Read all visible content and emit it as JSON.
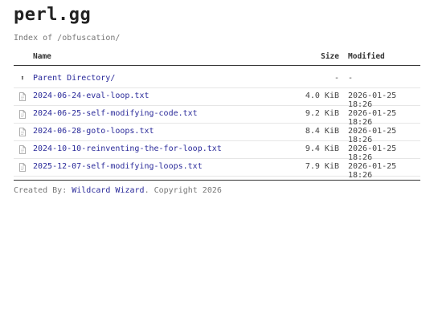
{
  "site": {
    "title": "perl.gg",
    "index_path": "Index of /obfuscation/"
  },
  "table": {
    "headers": {
      "name": "Name",
      "size": "Size",
      "modified": "Modified"
    },
    "parent": {
      "icon": "up-arrow-icon",
      "glyph": "⬆",
      "name": "Parent Directory/",
      "size": "-",
      "modified": "-"
    },
    "files": [
      {
        "icon": "file-icon",
        "name": "2024-06-24-eval-loop.txt",
        "size": "4.0 KiB",
        "modified": "2026-01-25 18:26"
      },
      {
        "icon": "file-icon",
        "name": "2024-06-25-self-modifying-code.txt",
        "size": "9.2 KiB",
        "modified": "2026-01-25 18:26"
      },
      {
        "icon": "file-icon",
        "name": "2024-06-28-goto-loops.txt",
        "size": "8.4 KiB",
        "modified": "2026-01-25 18:26"
      },
      {
        "icon": "file-icon",
        "name": "2024-10-10-reinventing-the-for-loop.txt",
        "size": "9.4 KiB",
        "modified": "2026-01-25 18:26"
      },
      {
        "icon": "file-icon",
        "name": "2025-12-07-self-modifying-loops.txt",
        "size": "7.9 KiB",
        "modified": "2026-01-25 18:26"
      }
    ]
  },
  "footer": {
    "prefix": "Created By: ",
    "author": "Wildcard Wizard",
    "suffix": ". Copyright 2026"
  },
  "colors": {
    "link": "#2a2a9a",
    "muted": "#777777",
    "rule": "#333333"
  }
}
